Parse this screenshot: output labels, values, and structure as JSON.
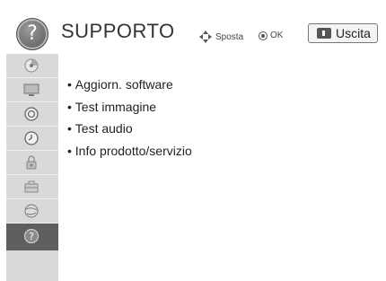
{
  "header": {
    "title": "SUPPORTO",
    "move_hint": "Sposta",
    "ok_hint": "OK",
    "exit_label": "Uscita",
    "help_glyph": "?"
  },
  "sidebar": {
    "items": [
      {
        "icon": "disc-icon"
      },
      {
        "icon": "monitor-icon"
      },
      {
        "icon": "speaker-icon"
      },
      {
        "icon": "clock-icon"
      },
      {
        "icon": "lock-icon"
      },
      {
        "icon": "toolbox-icon"
      },
      {
        "icon": "globe-icon"
      },
      {
        "icon": "help-icon",
        "active": true,
        "glyph": "?"
      }
    ]
  },
  "menu": {
    "items": [
      {
        "label": "Aggiorn. software"
      },
      {
        "label": "Test immagine"
      },
      {
        "label": "Test audio"
      },
      {
        "label": "Info prodotto/servizio"
      }
    ]
  },
  "colors": {
    "sidebar_bg": "#d9d9d9",
    "active_bg": "#5f5f5f",
    "text": "#222222"
  }
}
